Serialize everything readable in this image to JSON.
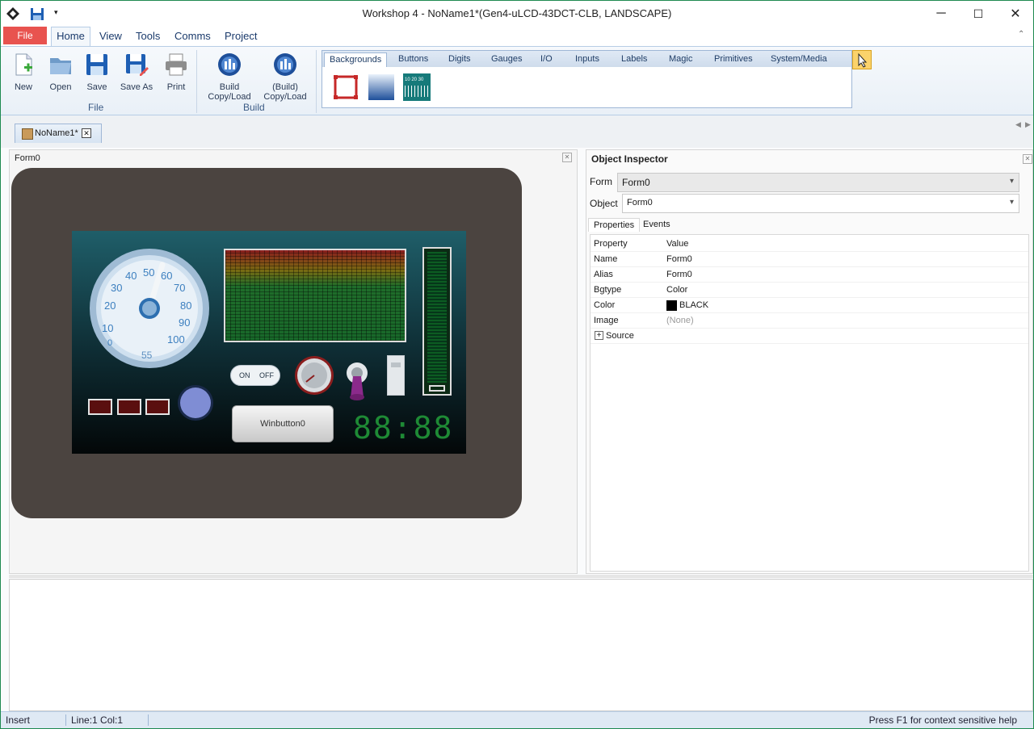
{
  "window": {
    "title": "Workshop 4 - NoName1*(Gen4-uLCD-43DCT-CLB, LANDSCAPE)",
    "controls": {
      "minimize": "─",
      "maximize": "☐",
      "close": "✕"
    }
  },
  "menubar": {
    "file": "File",
    "items": [
      "Home",
      "View",
      "Tools",
      "Comms",
      "Project"
    ]
  },
  "ribbon": {
    "file_group": {
      "label": "File",
      "buttons": [
        {
          "label": "New",
          "icon": "new-file-icon"
        },
        {
          "label": "Open",
          "icon": "open-folder-icon"
        },
        {
          "label": "Save",
          "icon": "save-icon"
        },
        {
          "label": "Save As",
          "icon": "save-as-icon"
        },
        {
          "label": "Print",
          "icon": "printer-icon"
        }
      ]
    },
    "build_group": {
      "label": "Build",
      "buttons": [
        {
          "label1": "Build",
          "label2": "Copy/Load",
          "icon": "build-icon"
        },
        {
          "label1": "(Build)",
          "label2": "Copy/Load",
          "icon": "build-copy-icon"
        }
      ]
    },
    "widget_tabs": [
      "Backgrounds",
      "Buttons",
      "Digits",
      "Gauges",
      "I/O",
      "Inputs",
      "Labels",
      "Magic",
      "Primitives",
      "System/Media"
    ],
    "active_widget_tab": "Backgrounds",
    "widget_icons": [
      "form-background-icon",
      "gradient-background-icon",
      "scale-background-icon"
    ],
    "scale_icon_numbers": "10 20 30"
  },
  "document": {
    "tab": "NoName1*",
    "form_title": "Form0",
    "widgets": {
      "gauge_numbers": [
        "0",
        "10",
        "20",
        "30",
        "40",
        "50",
        "60",
        "70",
        "80",
        "90",
        "100"
      ],
      "gauge_value": "55",
      "switch_on": "ON",
      "switch_off": "OFF",
      "winbutton": "Winbutton0",
      "digits": "88:88"
    }
  },
  "inspector": {
    "title": "Object Inspector",
    "form_label": "Form",
    "form_value": "Form0",
    "object_label": "Object",
    "object_value": "Form0",
    "tabs": [
      "Properties",
      "Events"
    ],
    "headers": {
      "property": "Property",
      "value": "Value"
    },
    "rows": [
      {
        "property": "Name",
        "value": "Form0"
      },
      {
        "property": "Alias",
        "value": "Form0"
      },
      {
        "property": "Bgtype",
        "value": "Color"
      },
      {
        "property": "Color",
        "value": "BLACK",
        "swatch": "#000000"
      },
      {
        "property": "Image",
        "value": "(None)"
      },
      {
        "property": "Source",
        "value": ""
      }
    ]
  },
  "statusbar": {
    "mode": "Insert",
    "position": "Line:1 Col:1",
    "help": "Press F1 for context sensitive help"
  },
  "colors": {
    "accent": "#e8534f",
    "ribbon_border": "#b7cde6",
    "device_bezel": "#4b4440"
  }
}
